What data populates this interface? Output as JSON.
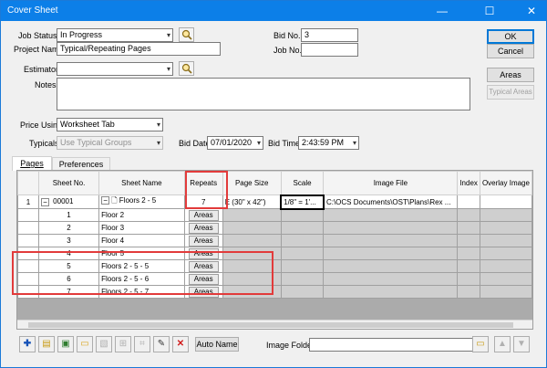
{
  "window": {
    "title": "Cover Sheet",
    "minimize": "—",
    "maximize": "☐",
    "close": "✕"
  },
  "form": {
    "job_status_label": "Job Status",
    "job_status_value": "In Progress",
    "project_name_label": "Project Name",
    "project_name_value": "Typical/Repeating Pages",
    "estimator_label": "Estimator",
    "estimator_value": "",
    "notes_label": "Notes",
    "notes_value": "",
    "bid_no_label": "Bid No.",
    "bid_no_value": "3",
    "job_no_label": "Job No.",
    "job_no_value": "",
    "price_using_label": "Price Using",
    "price_using_value": "Worksheet Tab",
    "typicals_label": "Typicals",
    "typicals_value": "Use Typical Groups",
    "bid_date_label": "Bid Date",
    "bid_date_value": "07/01/2020",
    "bid_time_label": "Bid Time",
    "bid_time_value": "2:43:59 PM"
  },
  "buttons": {
    "ok": "OK",
    "cancel": "Cancel",
    "areas": "Areas",
    "typical_areas": "Typical Areas",
    "auto_name": "Auto Name",
    "image_folder_label": "Image Folder"
  },
  "tabs": [
    {
      "label": "Pages",
      "active": true
    },
    {
      "label": "Preferences",
      "active": false
    }
  ],
  "grid": {
    "columns": [
      "",
      "Sheet No.",
      "Sheet Name",
      "Repeats",
      "Page Size",
      "Scale",
      "Image File",
      "Index",
      "Overlay Image"
    ],
    "parent_row": {
      "row_num": "1",
      "sheet_no": "00001",
      "sheet_name": "Floors 2 - 5",
      "repeats": "7",
      "page_size": "E (30\" x 42\")",
      "scale": "1/8\" = 1'...",
      "image_file": "C:\\OCS Documents\\OST\\Plans\\Rex ..."
    },
    "child_rows": [
      {
        "sheet_no": "1",
        "sheet_name": "Floor 2",
        "areas": "Areas"
      },
      {
        "sheet_no": "2",
        "sheet_name": "Floor 3",
        "areas": "Areas"
      },
      {
        "sheet_no": "3",
        "sheet_name": "Floor 4",
        "areas": "Areas"
      },
      {
        "sheet_no": "4",
        "sheet_name": "Floor 5",
        "areas": "Areas"
      },
      {
        "sheet_no": "5",
        "sheet_name": "Floors 2 - 5 - 5",
        "areas": "Areas"
      },
      {
        "sheet_no": "6",
        "sheet_name": "Floors 2 - 5 - 6",
        "areas": "Areas"
      },
      {
        "sheet_no": "7",
        "sheet_name": "Floors 2 - 5 - 7",
        "areas": "Areas"
      }
    ]
  },
  "colors": {
    "titlebar": "#0c7fe8",
    "highlight_box": "#e23b3b",
    "default_button_border": "#0078d7"
  },
  "toolbar_icons": [
    "add-sheet-icon",
    "insert-sheet-icon",
    "image-icon",
    "folder-icon",
    "calibrate-icon",
    "scale-icon",
    "crop-icon",
    "edit-icon",
    "delete-icon"
  ]
}
